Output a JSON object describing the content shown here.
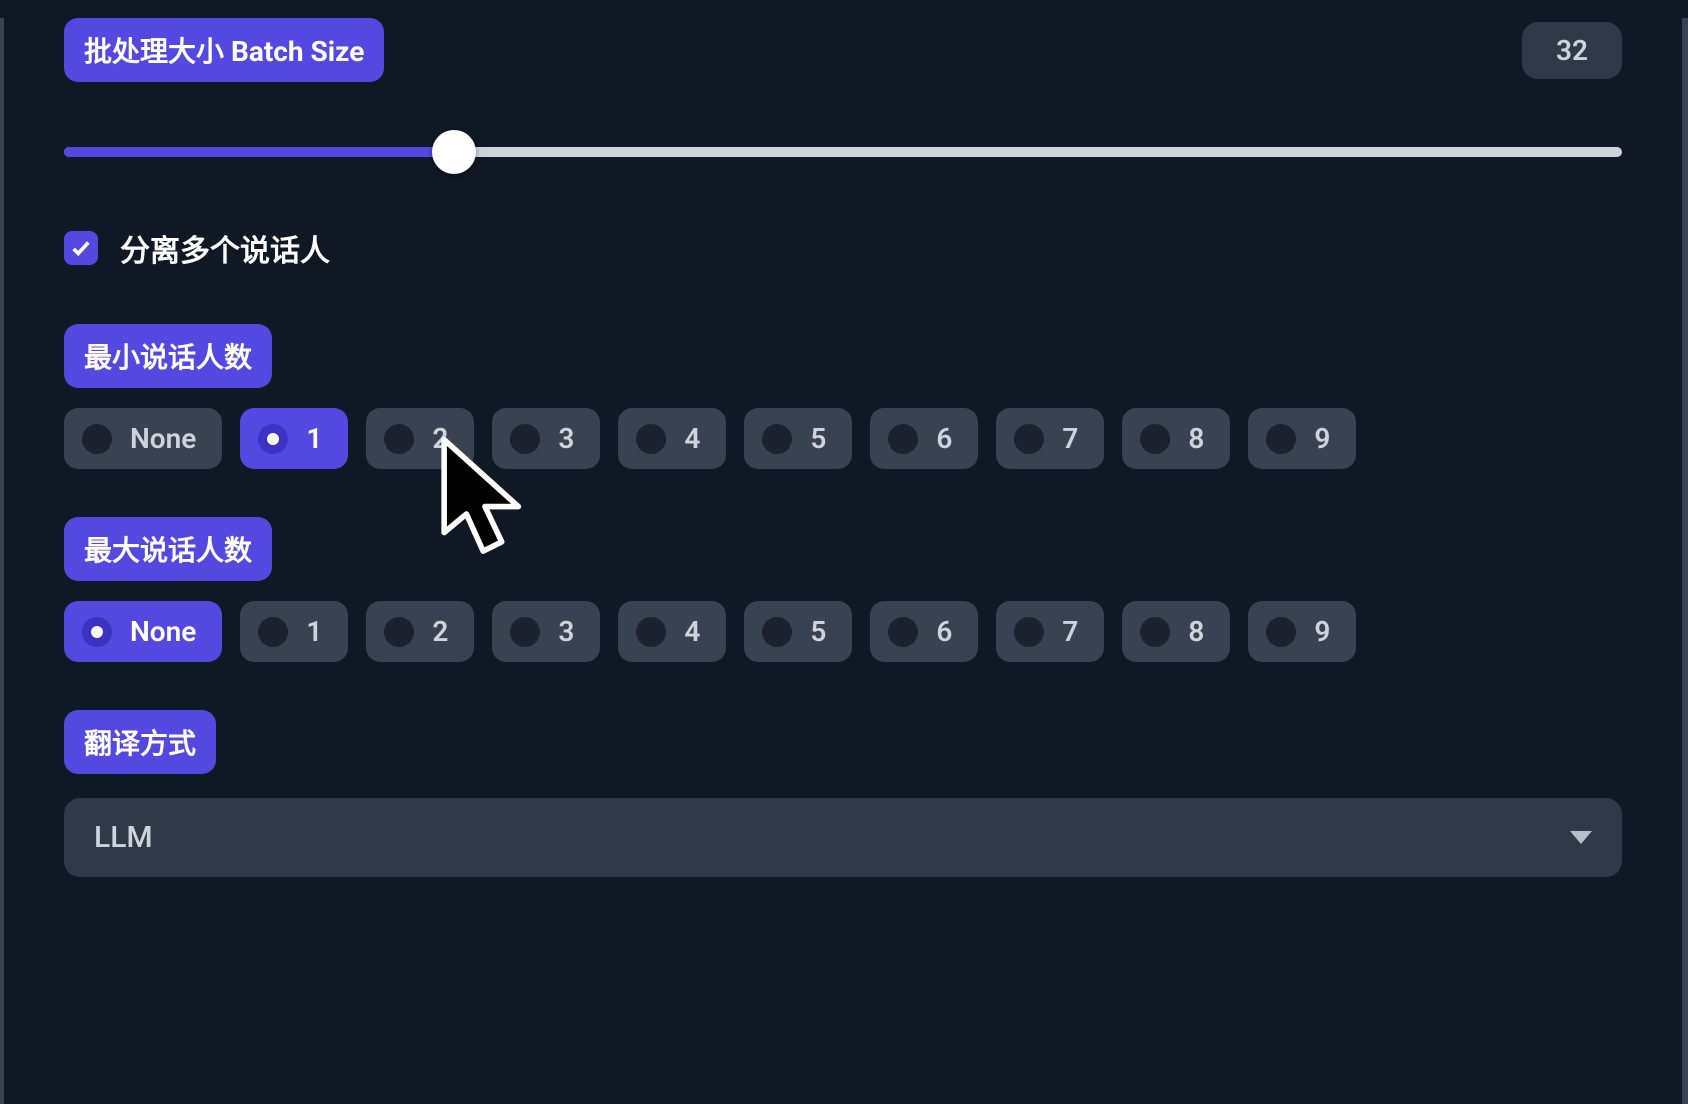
{
  "batch": {
    "label": "批处理大小 Batch Size",
    "value": "32",
    "slider_percent": 25
  },
  "diarize": {
    "checkbox_checked": true,
    "checkbox_label": "分离多个说话人"
  },
  "min_speakers": {
    "label": "最小说话人数",
    "options": [
      "None",
      "1",
      "2",
      "3",
      "4",
      "5",
      "6",
      "7",
      "8",
      "9"
    ],
    "selected": "1"
  },
  "max_speakers": {
    "label": "最大说话人数",
    "options": [
      "None",
      "1",
      "2",
      "3",
      "4",
      "5",
      "6",
      "7",
      "8",
      "9"
    ],
    "selected": "None"
  },
  "translate": {
    "label": "翻译方式",
    "selected": "LLM"
  },
  "colors": {
    "accent": "#5349e0",
    "panel_bg": "#0f1824",
    "chip_bg": "#3a4150",
    "value_pill_bg": "#2f3947"
  }
}
